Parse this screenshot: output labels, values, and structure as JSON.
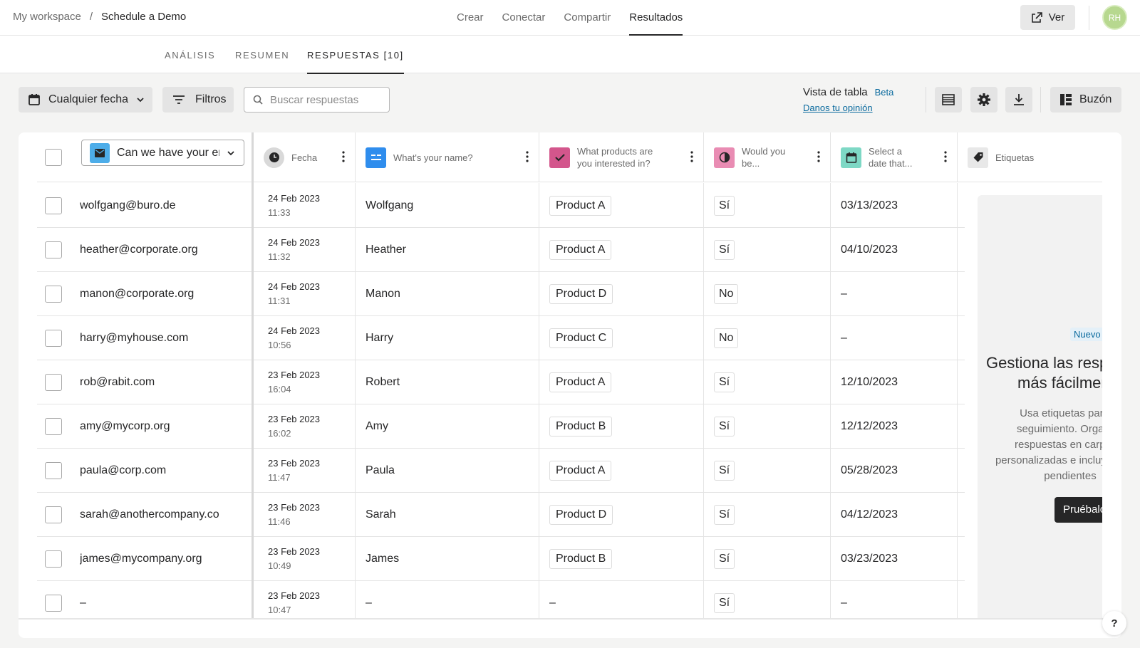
{
  "breadcrumb": {
    "workspace": "My workspace",
    "separator": "/",
    "form": "Schedule a Demo"
  },
  "nav": [
    "Crear",
    "Conectar",
    "Compartir",
    "Resultados"
  ],
  "nav_active": "Resultados",
  "view_button": "Ver",
  "avatar": "RH",
  "subtabs": [
    "ANÁLISIS",
    "RESUMEN",
    "RESPUESTAS [10]"
  ],
  "subtab_active": "RESPUESTAS [10]",
  "toolbar": {
    "date_filter": "Cualquier fecha",
    "filters": "Filtros",
    "search_placeholder": "Buscar respuestas",
    "table_view": "Vista de tabla",
    "beta": "Beta",
    "feedback": "Danos tu opinión",
    "inbox": "Buzón"
  },
  "table": {
    "email_select": "Can we have your email",
    "headers": {
      "date": "Fecha",
      "name": "What's your name?",
      "products_1": "What products are",
      "products_2": "you interested in?",
      "would_1": "Would you",
      "would_2": "be...",
      "select_1": "Select a",
      "select_2": "date that...",
      "tags": "Etiquetas"
    },
    "rows": [
      {
        "email": "wolfgang@buro.de",
        "date": "24 Feb 2023",
        "time": "11:33",
        "name": "Wolfgang",
        "product": "Product A",
        "answer": "Sí",
        "selected_date": "03/13/2023"
      },
      {
        "email": "heather@corporate.org",
        "date": "24 Feb 2023",
        "time": "11:32",
        "name": "Heather",
        "product": "Product A",
        "answer": "Sí",
        "selected_date": "04/10/2023"
      },
      {
        "email": "manon@corporate.org",
        "date": "24 Feb 2023",
        "time": "11:31",
        "name": "Manon",
        "product": "Product D",
        "answer": "No",
        "selected_date": "–"
      },
      {
        "email": "harry@myhouse.com",
        "date": "24 Feb 2023",
        "time": "10:56",
        "name": "Harry",
        "product": "Product C",
        "answer": "No",
        "selected_date": "–"
      },
      {
        "email": "rob@rabit.com",
        "date": "23 Feb 2023",
        "time": "16:04",
        "name": "Robert",
        "product": "Product A",
        "answer": "Sí",
        "selected_date": "12/10/2023"
      },
      {
        "email": "amy@mycorp.org",
        "date": "23 Feb 2023",
        "time": "16:02",
        "name": "Amy",
        "product": "Product B",
        "answer": "Sí",
        "selected_date": "12/12/2023"
      },
      {
        "email": "paula@corp.com",
        "date": "23 Feb 2023",
        "time": "11:47",
        "name": "Paula",
        "product": "Product A",
        "answer": "Sí",
        "selected_date": "05/28/2023"
      },
      {
        "email": "sarah@anothercompany.co",
        "date": "23 Feb 2023",
        "time": "11:46",
        "name": "Sarah",
        "product": "Product D",
        "answer": "Sí",
        "selected_date": "04/12/2023"
      },
      {
        "email": "james@mycompany.org",
        "date": "23 Feb 2023",
        "time": "10:49",
        "name": "James",
        "product": "Product B",
        "answer": "Sí",
        "selected_date": "03/23/2023"
      },
      {
        "email": "–",
        "date": "23 Feb 2023",
        "time": "10:47",
        "name": "–",
        "product": "–",
        "answer": "Sí",
        "selected_date": "–"
      }
    ]
  },
  "promo": {
    "badge": "Nuevo",
    "title": "Gestiona las respuestas más fácilmente",
    "body": "Usa etiquetas para el seguimiento. Organiza respuestas en carpetas personalizadas e incluye tareas pendientes",
    "button": "Pruébalo"
  },
  "help": "?",
  "colors": {
    "email_icon": "#4dade9",
    "date_icon": "#d9d9d9",
    "name_icon": "#2f8ded",
    "products_icon": "#d3568c",
    "would_icon": "#e98cb3",
    "select_icon": "#7ed8c5",
    "tags_icon": "#e8e8e8"
  }
}
